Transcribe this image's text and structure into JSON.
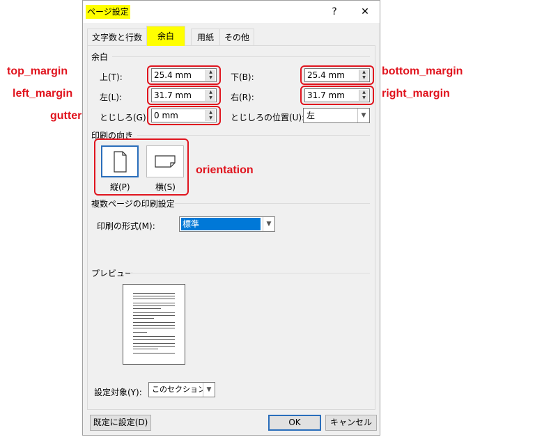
{
  "dialog": {
    "title": "ページ設定",
    "help_label": "?",
    "close_label": "✕"
  },
  "tabs": [
    {
      "label": "文字数と行数",
      "active": false
    },
    {
      "label": "余白",
      "active": true
    },
    {
      "label": "用紙",
      "active": false
    },
    {
      "label": "その他",
      "active": false
    }
  ],
  "margins": {
    "group_label": "余白",
    "top_label": "上(T):",
    "top_value": "25.4 mm",
    "bottom_label": "下(B):",
    "bottom_value": "25.4 mm",
    "left_label": "左(L):",
    "left_value": "31.7 mm",
    "right_label": "右(R):",
    "right_value": "31.7 mm",
    "gutter_label": "とじしろ(G):",
    "gutter_value": "0 mm",
    "gutter_pos_label": "とじしろの位置(U):",
    "gutter_pos_value": "左"
  },
  "orientation": {
    "group_label": "印刷の向き",
    "portrait_label": "縦(P)",
    "landscape_label": "横(S)",
    "selected": "portrait"
  },
  "multiple_pages": {
    "group_label": "複数ページの印刷設定",
    "format_label": "印刷の形式(M):",
    "format_value": "標準"
  },
  "preview": {
    "group_label": "プレビュー"
  },
  "apply_to": {
    "label": "設定対象(Y):",
    "value": "このセクション"
  },
  "buttons": {
    "set_default": "既定に設定(D)",
    "ok": "OK",
    "cancel": "キャンセル"
  },
  "annotations": {
    "top_margin": "top_margin",
    "bottom_margin": "bottom_margin",
    "left_margin": "left_margin",
    "right_margin": "right_margin",
    "gutter": "gutter",
    "orientation": "orientation"
  },
  "colors": {
    "annotation": "#e0141e",
    "highlight": "#ffff00",
    "accent": "#2a6ebb"
  }
}
